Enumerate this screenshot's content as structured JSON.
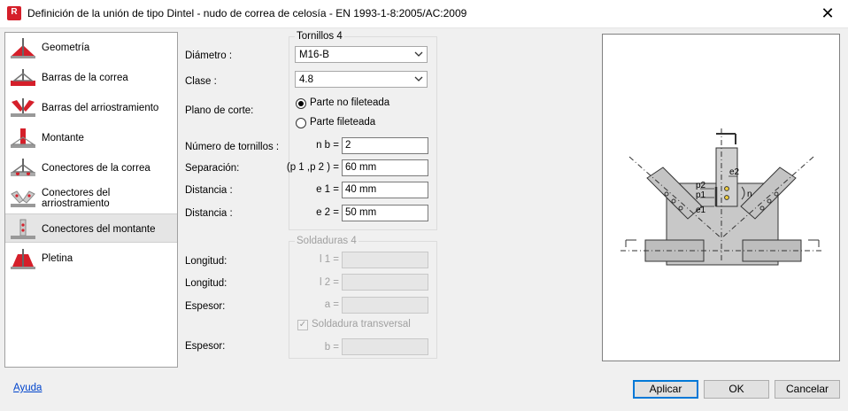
{
  "window": {
    "title": "Definición de la unión de tipo Dintel - nudo de correa de celosía - EN 1993-1-8:2005/AC:2009",
    "app_icon_letter": "R",
    "close_glyph": "✕"
  },
  "sidebar": {
    "items": [
      {
        "label": "Geometría"
      },
      {
        "label": "Barras de la correa"
      },
      {
        "label": "Barras del arriostramiento"
      },
      {
        "label": "Montante"
      },
      {
        "label": "Conectores de la correa"
      },
      {
        "label": "Conectores del arriostramiento"
      },
      {
        "label": "Conectores del montante"
      },
      {
        "label": "Pletina"
      }
    ],
    "selected_index": 6
  },
  "bolts": {
    "group_title": "Tornillos 4",
    "diameter_label": "Diámetro :",
    "diameter_value": "M16-B",
    "class_label": "Clase :",
    "class_value": "4.8",
    "shear_plane_label": "Plano de corte:",
    "shear_option_1": "Parte no fileteada",
    "shear_option_2": "Parte fileteada",
    "selected_shear_option": 1,
    "count_label": "Número de tornillos :",
    "count_symbol": "n b =",
    "count_value": "2",
    "spacing_label": "Separación:",
    "spacing_symbol": "(p 1 ,p 2 ) =",
    "spacing_value": "60 mm",
    "distance1_label": "Distancia :",
    "distance1_symbol": "e 1 =",
    "distance1_value": "40 mm",
    "distance2_label": "Distancia :",
    "distance2_symbol": "e 2 =",
    "distance2_value": "50 mm"
  },
  "welds": {
    "group_title": "Soldaduras 4",
    "length1_label": "Longitud:",
    "length1_symbol": "l 1 =",
    "length2_label": "Longitud:",
    "length2_symbol": "l 2 =",
    "thickness_label": "Espesor:",
    "thickness_symbol": "a =",
    "transverse_label": "Soldadura transversal",
    "transverse_checked": true,
    "thickness2_label": "Espesor:",
    "thickness2_symbol": "b ="
  },
  "preview": {
    "labels": {
      "p2": "p2",
      "p1": "p1",
      "e1": "e1",
      "e2": "e2",
      "n": "n"
    }
  },
  "footer": {
    "help": "Ayuda",
    "apply": "Aplicar",
    "ok": "OK",
    "cancel": "Cancelar"
  },
  "colors": {
    "accent": "#0078d7",
    "icon_red": "#d51f2a",
    "link": "#0044cc"
  }
}
